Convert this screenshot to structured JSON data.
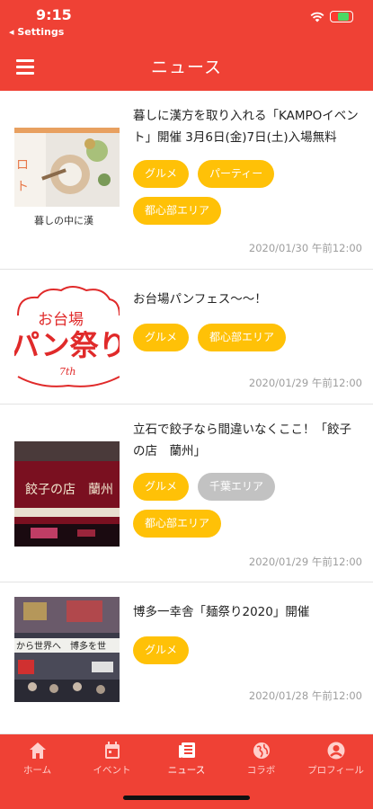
{
  "status_bar": {
    "time": "9:15",
    "back_label": "◂ Settings"
  },
  "app_bar": {
    "title": "ニュース"
  },
  "news": [
    {
      "title": "暮しに漢方を取り入れる「KAMPOイベント」開催 3月6日(金)7日(土)入場無料",
      "tags": [
        "グルメ",
        "パーティー",
        "都心部エリア"
      ],
      "date": "2020/01/30 午前12:00",
      "image_text": "暮しの中に漢",
      "image_side_text": "ロ\nト"
    },
    {
      "title": "お台場パンフェス〜〜！",
      "tags": [
        "グルメ",
        "都心部エリア"
      ],
      "date": "2020/01/29 午前12:00",
      "image_text_top": "お台場",
      "image_text_main": "パン祭り",
      "image_text_sub": "7th"
    },
    {
      "title": "立石で餃子なら間違いなくここ！「餃子の店　蘭州」",
      "tags": [
        "グルメ",
        "千葉エリア",
        "都心部エリア"
      ],
      "date": "2020/01/29 午前12:00",
      "image_text": "餃子の店　蘭州"
    },
    {
      "title": "博多一幸舎「麺祭り2020」開催",
      "tags": [
        "グルメ"
      ],
      "date": "2020/01/28 午前12:00",
      "image_text": "から世界へ　博多を世"
    }
  ],
  "tab_bar": {
    "items": [
      {
        "label": "ホーム",
        "icon": "home-icon"
      },
      {
        "label": "イベント",
        "icon": "calendar-icon"
      },
      {
        "label": "ニュース",
        "icon": "news-icon"
      },
      {
        "label": "コラボ",
        "icon": "globe-icon"
      },
      {
        "label": "プロフィール",
        "icon": "profile-icon"
      }
    ],
    "active_index": 2
  },
  "colors": {
    "primary": "#ef4135",
    "tag": "#ffc107",
    "tag_disabled": "#c2c2c2"
  }
}
